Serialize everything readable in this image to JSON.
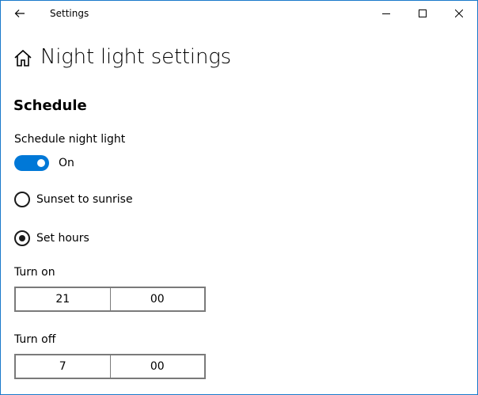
{
  "window": {
    "title": "Settings",
    "accent": "#0078d7"
  },
  "header": {
    "page_title": "Night light settings",
    "home_icon": "home-icon",
    "back_icon": "back-arrow-icon"
  },
  "schedule": {
    "section_title": "Schedule",
    "toggle_label": "Schedule night light",
    "toggle_state": "On",
    "toggle_on": true,
    "options": [
      {
        "label": "Sunset to sunrise",
        "selected": false
      },
      {
        "label": "Set hours",
        "selected": true
      }
    ],
    "turn_on": {
      "label": "Turn on",
      "hour": "21",
      "minute": "00"
    },
    "turn_off": {
      "label": "Turn off",
      "hour": "7",
      "minute": "00"
    }
  }
}
